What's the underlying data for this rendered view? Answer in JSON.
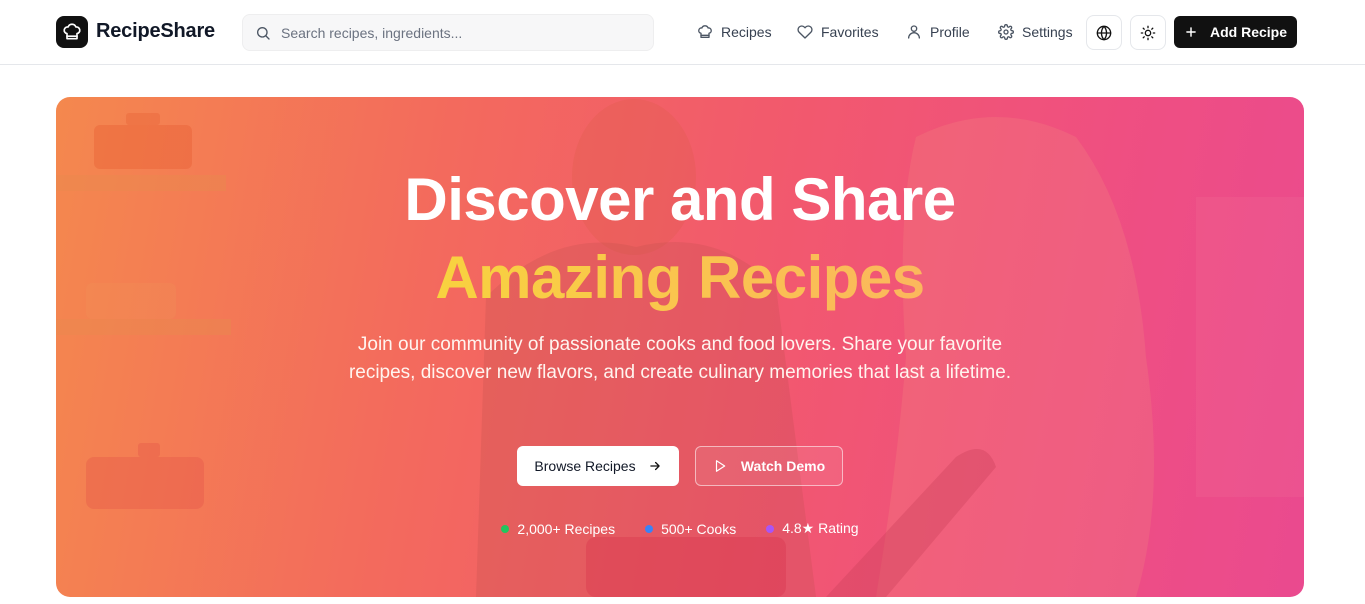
{
  "header": {
    "brand": "RecipeShare",
    "search_placeholder": "Search recipes, ingredients...",
    "nav": [
      {
        "label": "Recipes",
        "icon": "chef-hat-icon"
      },
      {
        "label": "Favorites",
        "icon": "heart-icon"
      },
      {
        "label": "Profile",
        "icon": "user-icon"
      },
      {
        "label": "Settings",
        "icon": "gear-icon"
      }
    ],
    "add_recipe_label": "Add Recipe"
  },
  "hero": {
    "title_line1": "Discover and Share",
    "title_line2": "Amazing Recipes",
    "subtitle": "Join our community of passionate cooks and food lovers. Share your favorite recipes, discover new flavors, and create culinary memories that last a lifetime.",
    "browse_label": "Browse Recipes",
    "demo_label": "Watch Demo",
    "stats": [
      {
        "label": "2,000+ Recipes",
        "color": "#22c55e"
      },
      {
        "label": "500+ Cooks",
        "color": "#3b82f6"
      },
      {
        "label": "4.8★ Rating",
        "color": "#a855f7"
      }
    ]
  },
  "colors": {
    "accent_dark": "#111111",
    "highlight": "#f9c744",
    "hero_gradient_start": "#f4884e",
    "hero_gradient_end": "#ea4a8f"
  }
}
